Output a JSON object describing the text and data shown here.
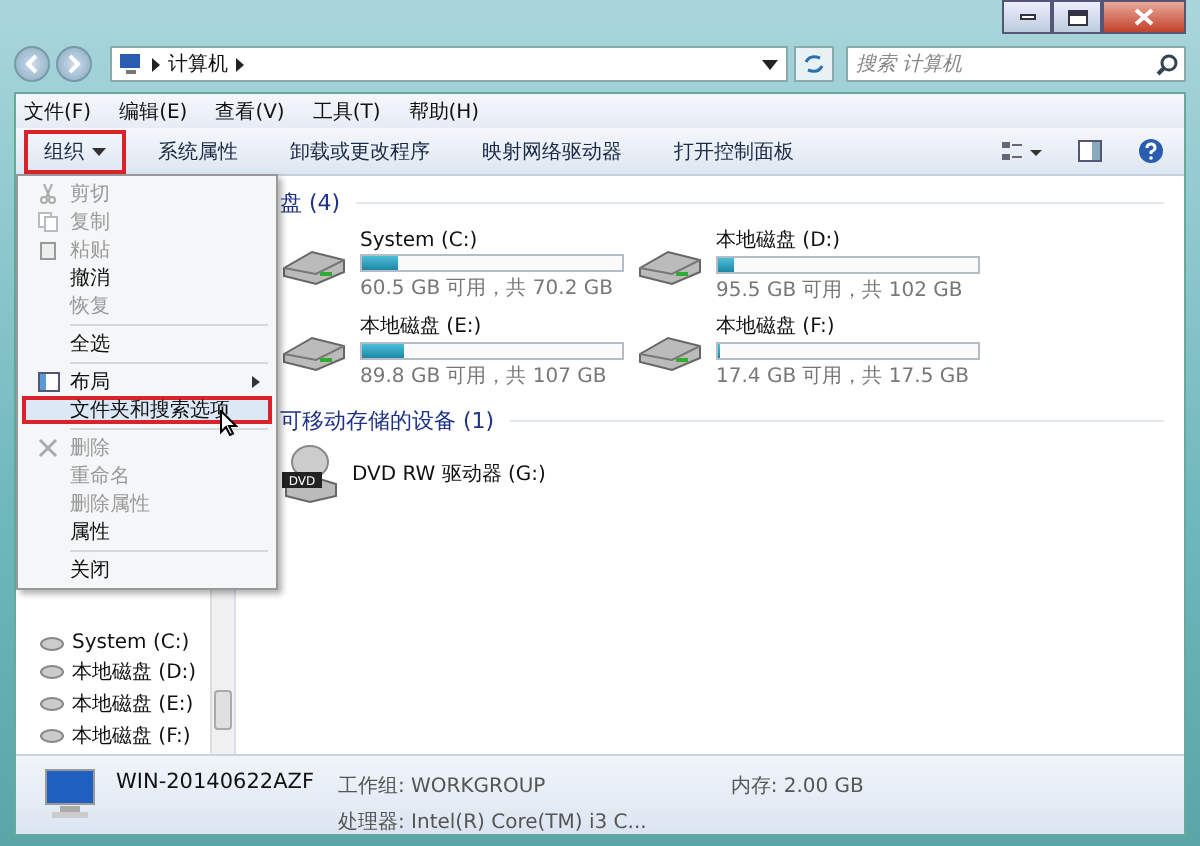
{
  "address_bar": {
    "breadcrumb": "计算机"
  },
  "search": {
    "placeholder": "搜索 计算机"
  },
  "menu_bar": [
    "文件(F)",
    "编辑(E)",
    "查看(V)",
    "工具(T)",
    "帮助(H)"
  ],
  "toolbar": [
    {
      "label": "组织",
      "dropdown": true,
      "highlighted": true
    },
    {
      "label": "系统属性",
      "dropdown": false,
      "highlighted": false
    },
    {
      "label": "卸载或更改程序",
      "dropdown": false,
      "highlighted": false
    },
    {
      "label": "映射网络驱动器",
      "dropdown": false,
      "highlighted": false
    },
    {
      "label": "打开控制面板",
      "dropdown": false,
      "highlighted": false
    }
  ],
  "organize_menu": [
    {
      "kind": "item",
      "label": "剪切",
      "disabled": true,
      "submenu": false,
      "highlighted": false
    },
    {
      "kind": "item",
      "label": "复制",
      "disabled": true,
      "submenu": false,
      "highlighted": false
    },
    {
      "kind": "item",
      "label": "粘贴",
      "disabled": true,
      "submenu": false,
      "highlighted": false
    },
    {
      "kind": "item",
      "label": "撤消",
      "disabled": false,
      "submenu": false,
      "highlighted": false
    },
    {
      "kind": "item",
      "label": "恢复",
      "disabled": true,
      "submenu": false,
      "highlighted": false
    },
    {
      "kind": "separator"
    },
    {
      "kind": "item",
      "label": "全选",
      "disabled": false,
      "submenu": false,
      "highlighted": false
    },
    {
      "kind": "separator"
    },
    {
      "kind": "item",
      "label": "布局",
      "disabled": false,
      "submenu": true,
      "highlighted": false
    },
    {
      "kind": "item",
      "label": "文件夹和搜索选项",
      "disabled": false,
      "submenu": false,
      "highlighted": true
    },
    {
      "kind": "separator"
    },
    {
      "kind": "item",
      "label": "删除",
      "disabled": true,
      "submenu": false,
      "highlighted": false
    },
    {
      "kind": "item",
      "label": "重命名",
      "disabled": true,
      "submenu": false,
      "highlighted": false
    },
    {
      "kind": "item",
      "label": "删除属性",
      "disabled": true,
      "submenu": false,
      "highlighted": false
    },
    {
      "kind": "item",
      "label": "属性",
      "disabled": false,
      "submenu": false,
      "highlighted": false
    },
    {
      "kind": "separator"
    },
    {
      "kind": "item",
      "label": "关闭",
      "disabled": false,
      "submenu": false,
      "highlighted": false
    }
  ],
  "nav_pane": [
    "System (C:)",
    "本地磁盘 (D:)",
    "本地磁盘 (E:)",
    "本地磁盘 (F:)"
  ],
  "hard_disks": {
    "heading": "盘 (4)",
    "drives": [
      {
        "name": "System (C:)",
        "level": 0.14,
        "space": "60.5 GB 可用，共 70.2 GB"
      },
      {
        "name": "本地磁盘 (D:)",
        "level": 0.06,
        "space": "95.5 GB 可用，共 102 GB"
      },
      {
        "name": "本地磁盘 (E:)",
        "level": 0.16,
        "space": "89.8 GB 可用，共 107 GB"
      },
      {
        "name": "本地磁盘 (F:)",
        "level": 0.01,
        "space": "17.4 GB 可用，共 17.5 GB"
      }
    ]
  },
  "removable": {
    "heading": "可移动存储的设备 (1)",
    "devices": [
      {
        "name": "DVD RW 驱动器 (G:)",
        "badge": "DVD"
      }
    ]
  },
  "status_bar": {
    "computer": "WIN-20140622AZF",
    "workgroup": "工作组: WORKGROUP",
    "memory": "内存: 2.00 GB",
    "processor": "处理器: Intel(R) Core(TM) i3 C..."
  }
}
